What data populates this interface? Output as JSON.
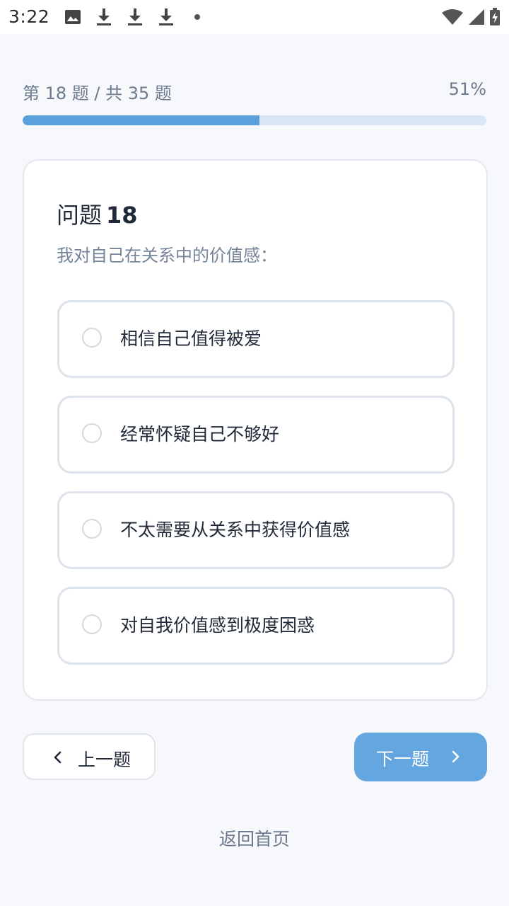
{
  "status_bar": {
    "time": "3:22",
    "left_icons": [
      "image-icon",
      "download-icon",
      "download-icon",
      "download-icon",
      "dot-icon"
    ],
    "right_icons": [
      "wifi-icon",
      "signal-icon",
      "battery-icon"
    ]
  },
  "progress": {
    "text": "第 18 题 / 共 35 题",
    "percent_label": "51%",
    "fraction": 0.51,
    "fill_color": "#5b9fdc",
    "track_color": "#d8e6f5"
  },
  "question": {
    "title_prefix": "问题",
    "number": "18",
    "text": "我对自己在关系中的价值感："
  },
  "options": [
    {
      "label": "相信自己值得被爱"
    },
    {
      "label": "经常怀疑自己不够好"
    },
    {
      "label": "不太需要从关系中获得价值感"
    },
    {
      "label": "对自我价值感到极度困惑"
    }
  ],
  "navigation": {
    "prev_label": "上一题",
    "next_label": "下一题",
    "home_label": "返回首页",
    "accent_color": "#64a6df"
  }
}
